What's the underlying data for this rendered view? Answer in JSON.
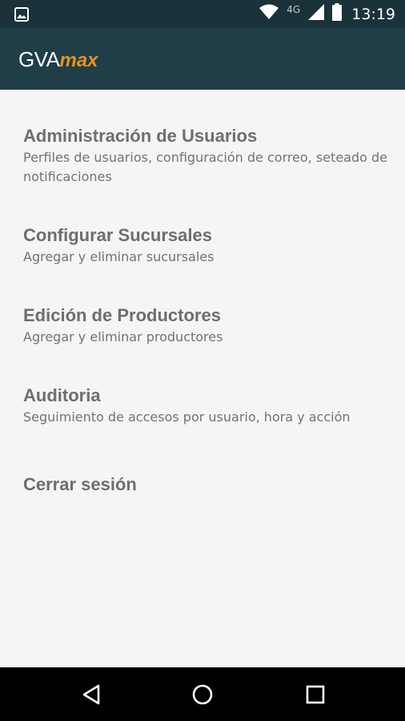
{
  "status_bar": {
    "network_label": "4G",
    "time": "13:19",
    "icons": [
      "gallery-icon",
      "wifi-icon",
      "signal-icon",
      "battery-icon"
    ]
  },
  "app_bar": {
    "logo_primary": "GVA",
    "logo_secondary": "max",
    "background": "#1f3e47",
    "accent": "#e8921b"
  },
  "menu": {
    "items": [
      {
        "title": "Administración de Usuarios",
        "description": "Perfiles de usuarios, configuración de correo, seteado de notificaciones"
      },
      {
        "title": "Configurar Sucursales",
        "description": "Agregar y eliminar sucursales"
      },
      {
        "title": "Edición de Productores",
        "description": "Agregar y eliminar productores"
      },
      {
        "title": "Auditoria",
        "description": "Seguimiento de accesos por usuario, hora y acción"
      },
      {
        "title": "Cerrar sesión"
      }
    ]
  },
  "nav_bar": {
    "buttons": [
      "back-icon",
      "home-icon",
      "recents-icon"
    ]
  }
}
